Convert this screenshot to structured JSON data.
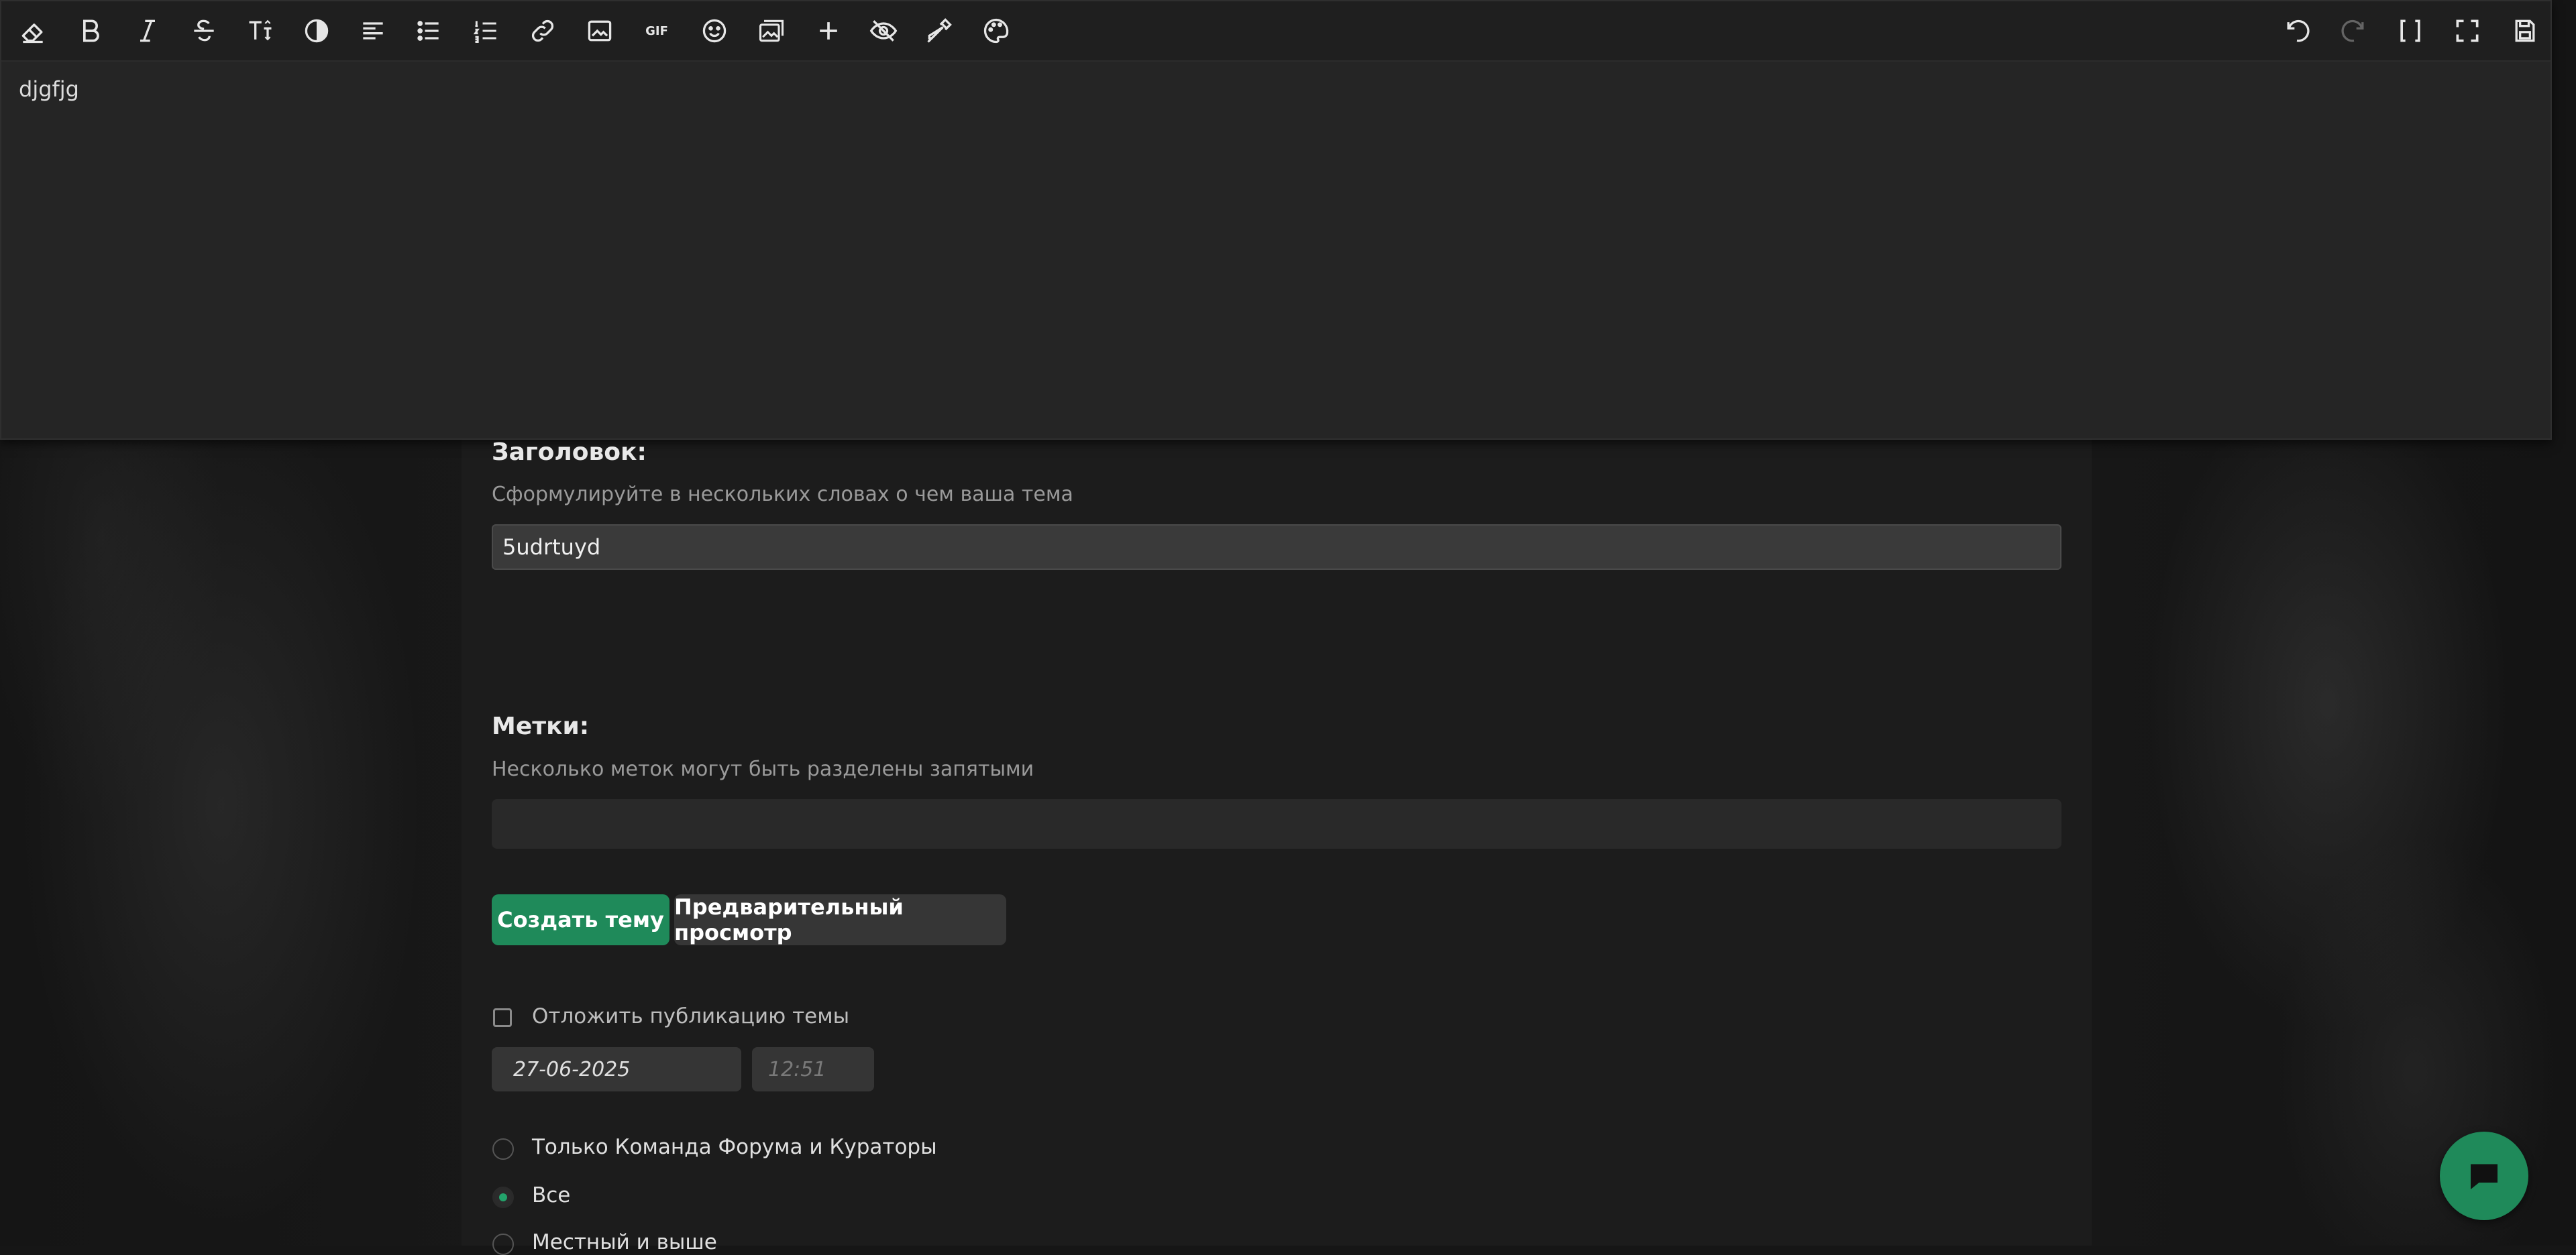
{
  "editor": {
    "content": "djgfjg",
    "toolbar_left": [
      "eraser-icon",
      "bold-icon",
      "italic-icon",
      "strikethrough-icon",
      "text-size-icon",
      "color-contrast-icon",
      "align-left-icon",
      "bullet-list-icon",
      "numbered-list-icon",
      "link-icon",
      "image-icon",
      "gif-icon",
      "emoji-icon",
      "media-gallery-icon",
      "plus-icon",
      "hide-icon",
      "eyedropper-icon",
      "palette-icon"
    ],
    "toolbar_right": [
      "undo-icon",
      "redo-icon",
      "bracket-mode-icon",
      "fullscreen-icon",
      "save-icon"
    ],
    "gif_label": "GIF"
  },
  "form": {
    "title_label": "Заголовок:",
    "title_hint": "Сформулируйте в нескольких словах о чем ваша тема",
    "title_value": "5udrtuyd",
    "tags_label": "Метки:",
    "tags_hint": "Несколько меток могут быть разделены запятыми",
    "tags_value": "",
    "create_button": "Создать тему",
    "preview_button": "Предварительный просмотр",
    "schedule_label": "Отложить публикацию темы",
    "schedule_checked": false,
    "date_value": "27-06-2025",
    "time_value": "12:51",
    "visibility_options": [
      {
        "label": "Только Команда Форума и Кураторы",
        "checked": false
      },
      {
        "label": "Все",
        "checked": true
      },
      {
        "label": "Местный и выше",
        "checked": false
      }
    ]
  },
  "colors": {
    "accent": "#1f8a5a",
    "radio_dot": "#23a36b",
    "editor_bg": "#252525",
    "toolbar_bg": "#1f1f1f"
  }
}
